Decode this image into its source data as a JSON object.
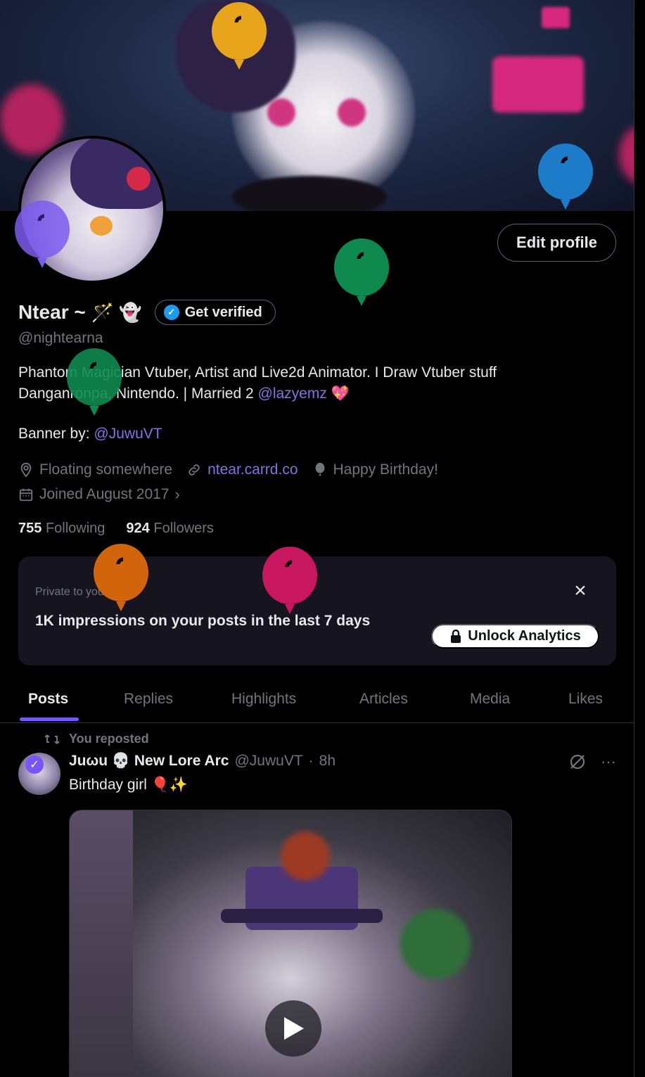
{
  "profile": {
    "display_name": "Ntear ~",
    "name_emojis": "🪄 👻",
    "verify_button": "Get verified",
    "handle": "@nightearna",
    "edit_button": "Edit profile"
  },
  "bio": {
    "line1": "Phantom Magician Vtuber, Artist and Live2d Animator. I Draw Vtuber stuff",
    "line2_prefix": "Danganronpa, Nintendo. | Married 2 ",
    "line2_mention": "@lazyemz",
    "line2_emoji": "💖",
    "banner_prefix": "Banner by: ",
    "banner_mention": "@JuwuVT"
  },
  "meta": {
    "location": "Floating somewhere",
    "website": "ntear.carrd.co",
    "birthday": "Happy Birthday!",
    "joined": "Joined August 2017"
  },
  "follow": {
    "following_count": "755",
    "following_label": "Following",
    "followers_count": "924",
    "followers_label": "Followers"
  },
  "analytics": {
    "private_label": "Private to you",
    "impressions_text": "1K impressions on your posts in the last 7 days",
    "unlock_button": "Unlock Analytics"
  },
  "tabs": [
    {
      "label": "Posts"
    },
    {
      "label": "Replies"
    },
    {
      "label": "Highlights"
    },
    {
      "label": "Articles"
    },
    {
      "label": "Media"
    },
    {
      "label": "Likes"
    }
  ],
  "post": {
    "repost_label": "You reposted",
    "author": "Juωu 💀 New Lore Arc",
    "handle": "@JuwuVT",
    "separator": "·",
    "time": "8h",
    "text": "Birthday girl 🎈✨",
    "more": "···"
  },
  "colors": {
    "accent": "#7856ff",
    "mention": "#8a6ee8",
    "verified": "#1d9bf0",
    "balloons": [
      "#7b5cf0",
      "#0e8a4f",
      "#0e8a4f",
      "#d2650c",
      "#c8165f",
      "#e8a51b",
      "#1d7cc9"
    ]
  }
}
